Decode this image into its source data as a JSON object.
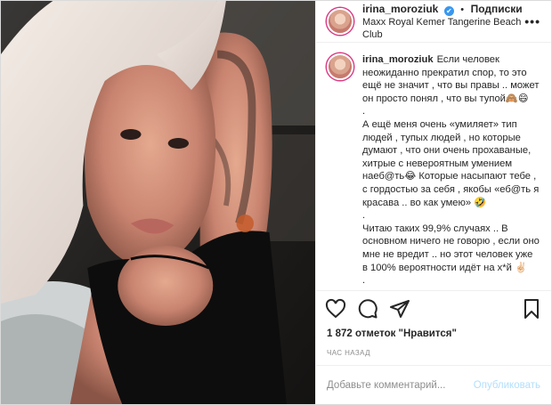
{
  "header": {
    "username": "irina_moroziuk",
    "verified_mark": "✔",
    "separator": "•",
    "follow_label": "Подписки",
    "location": "Maxx Royal Kemer Tangerine Beach Club",
    "more_label": "•••"
  },
  "caption": {
    "username": "irina_moroziuk",
    "text": "Если человек неожиданно прекратил спор, то это ещё не значит , что вы правы .. может он просто понял , что вы тупой🙈😄\n.\nА ещё меня очень «умиляет» тип людей , тупых людей , но которые думают , что они очень прохаваные, хитрые с невероятным умением наеб@ть😂 Которые насыпают тебе , с гордостью за себя , якобы «еб@ть я красава .. во как умею» 🤣\n.\nЧитаю таких 99,9% случаях .. В основном ничего не говорю , если оно мне не вредит .. но этот человек уже в 100% вероятности идёт на х*й ✌🏻\n."
  },
  "stats": {
    "likes": "1 872 отметок \"Нравится\"",
    "time": "ЧАС НАЗАД"
  },
  "comment_box": {
    "placeholder": "Добавьте комментарий...",
    "publish_label": "Опубликовать"
  },
  "colors": {
    "verified": "#3897f0",
    "publish_disabled": "#b2dffc",
    "muted": "#8e8e8e"
  },
  "icons": [
    "heart-icon",
    "comment-icon",
    "share-icon",
    "bookmark-icon"
  ]
}
